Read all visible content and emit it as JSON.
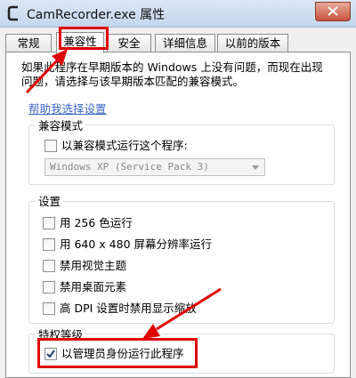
{
  "window": {
    "title": "CamRecorder.exe 属性"
  },
  "tabs": [
    {
      "label": "常规"
    },
    {
      "label": "兼容性"
    },
    {
      "label": "安全"
    },
    {
      "label": "详细信息"
    },
    {
      "label": "以前的版本"
    }
  ],
  "active_tab": "兼容性",
  "intro": {
    "text": "如果此程序在早期版本的 Windows 上没有问题，而现在出现问题，请选择与该早期版本匹配的兼容模式。"
  },
  "help_link": "帮助我选择设置",
  "compat_mode": {
    "group_title": "兼容模式",
    "checkbox_label": "以兼容模式运行这个程序:",
    "checked": false,
    "selected_os": "Windows XP (Service Pack 3)"
  },
  "settings": {
    "group_title": "设置",
    "items": [
      {
        "label": "用 256 色运行",
        "checked": false
      },
      {
        "label": "用 640 x 480 屏幕分辨率运行",
        "checked": false
      },
      {
        "label": "禁用视觉主题",
        "checked": false
      },
      {
        "label": "禁用桌面元素",
        "checked": false
      },
      {
        "label": "高 DPI 设置时禁用显示缩放",
        "checked": false
      }
    ]
  },
  "privilege": {
    "group_title": "特权等级",
    "checkbox_label": "以管理员身份运行此程序",
    "checked": true
  },
  "colors": {
    "annotation_red": "#e00000",
    "link_blue": "#3c66c8"
  }
}
